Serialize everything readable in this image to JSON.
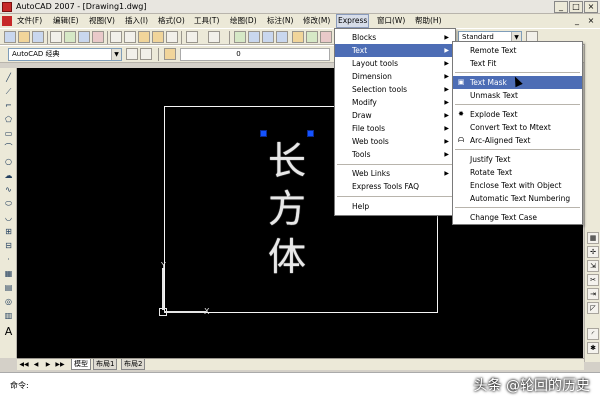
{
  "window": {
    "title": "AutoCAD 2007 - [Drawing1.dwg]",
    "controls": [
      "_",
      "□",
      "×"
    ]
  },
  "menubar": {
    "items": [
      {
        "label": "文件(F)"
      },
      {
        "label": "编辑(E)"
      },
      {
        "label": "视图(V)"
      },
      {
        "label": "插入(I)"
      },
      {
        "label": "格式(O)"
      },
      {
        "label": "工具(T)"
      },
      {
        "label": "绘图(D)"
      },
      {
        "label": "标注(N)"
      },
      {
        "label": "修改(M)"
      },
      {
        "label": "Express",
        "active": true
      },
      {
        "label": "窗口(W)"
      },
      {
        "label": "帮助(H)"
      }
    ],
    "mdi_controls": [
      "_",
      "×"
    ]
  },
  "toolbars": {
    "text_style_combo": "Standard",
    "workspace_combo": "AutoCAD 经典",
    "layer_combo": "0"
  },
  "express_menu": {
    "items": [
      {
        "label": "Blocks",
        "submenu": true
      },
      {
        "label": "Text",
        "submenu": true,
        "highlight": true
      },
      {
        "label": "Layout tools",
        "submenu": true
      },
      {
        "label": "Dimension",
        "submenu": true
      },
      {
        "label": "Selection tools",
        "submenu": true
      },
      {
        "label": "Modify",
        "submenu": true
      },
      {
        "label": "Draw",
        "submenu": true
      },
      {
        "label": "File tools",
        "submenu": true
      },
      {
        "label": "Web tools",
        "submenu": true
      },
      {
        "label": "Tools",
        "submenu": true
      },
      {
        "separator": true
      },
      {
        "label": "Web Links",
        "submenu": true
      },
      {
        "label": "Express Tools FAQ"
      },
      {
        "separator": true
      },
      {
        "label": "Help"
      }
    ]
  },
  "text_submenu": {
    "items": [
      {
        "label": "Remote Text"
      },
      {
        "label": "Text Fit"
      },
      {
        "separator": true
      },
      {
        "label": "Text Mask",
        "highlight": true,
        "icon": "text-mask-icon"
      },
      {
        "label": "Unmask Text"
      },
      {
        "separator": true
      },
      {
        "label": "Explode Text",
        "icon": "explode-text-icon"
      },
      {
        "label": "Convert Text to Mtext"
      },
      {
        "label": "Arc-Aligned Text",
        "icon": "arc-text-icon"
      },
      {
        "separator": true
      },
      {
        "label": "Justify Text"
      },
      {
        "label": "Rotate Text"
      },
      {
        "label": "Enclose Text with Object"
      },
      {
        "label": "Automatic Text Numbering"
      },
      {
        "separator": true
      },
      {
        "label": "Change Text Case"
      }
    ]
  },
  "drawing": {
    "characters": [
      "长",
      "方",
      "体"
    ],
    "ucs_x_label": "X",
    "ucs_y_label": "Y"
  },
  "layout_tabs": {
    "tabs": [
      {
        "label": "模型",
        "active": true
      },
      {
        "label": "布局1"
      },
      {
        "label": "布局2"
      }
    ]
  },
  "command_line": {
    "prompt": "命令:"
  },
  "watermark": "头条 @轮回的历史",
  "colors": {
    "highlight": "#4d6db5",
    "grip": "#1453ff",
    "canvas": "#000000"
  }
}
